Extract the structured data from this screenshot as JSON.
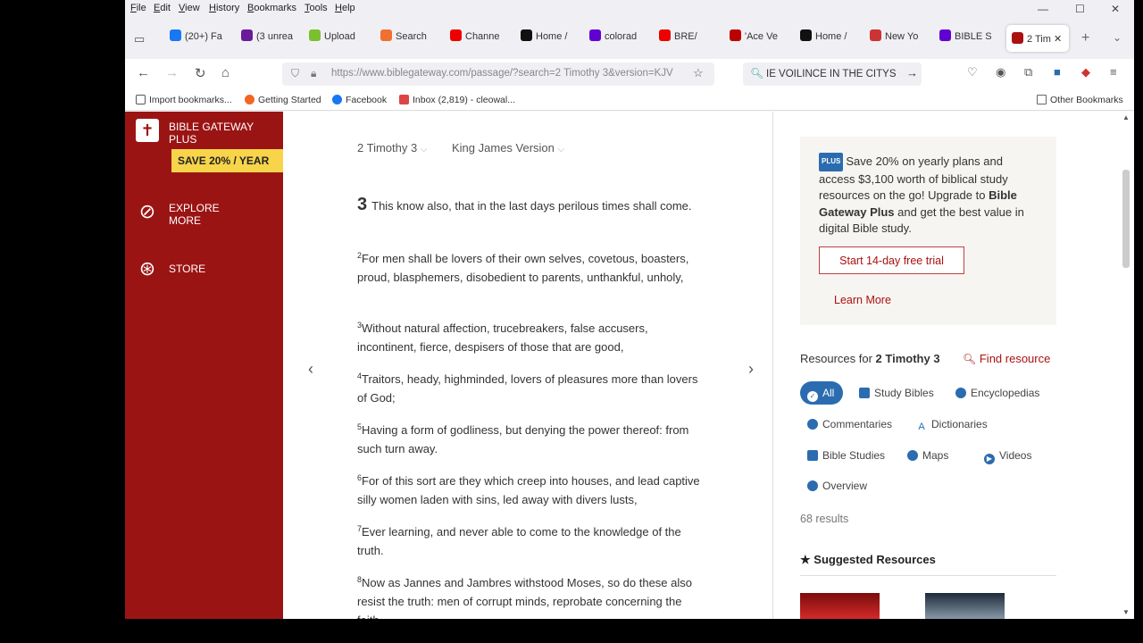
{
  "menu": [
    "File",
    "Edit",
    "View",
    "History",
    "Bookmarks",
    "Tools",
    "Help"
  ],
  "window_controls": {
    "minimize": "—",
    "maximize": "☐",
    "close": "✕"
  },
  "tabs": [
    {
      "label": "(20+) Fa",
      "color": "#1877f2"
    },
    {
      "label": "(3 unrea",
      "color": "#6a1b9a"
    },
    {
      "label": "Upload",
      "color": "#7cc02f"
    },
    {
      "label": "Search",
      "color": "#f07030"
    },
    {
      "label": "Channe",
      "color": "#e00"
    },
    {
      "label": "Home /",
      "color": "#111"
    },
    {
      "label": "colorad",
      "color": "#6001d2"
    },
    {
      "label": "BRE/",
      "color": "#e00"
    },
    {
      "label": "'Ace Ve",
      "color": "#b00"
    },
    {
      "label": "Home /",
      "color": "#111"
    },
    {
      "label": "New Yo",
      "color": "#c33"
    },
    {
      "label": "BIBLE S",
      "color": "#6001d2"
    },
    {
      "label": "2 Tim",
      "color": "#a11",
      "active": true
    }
  ],
  "nav": {
    "url": "https://www.biblegateway.com/passage/?search=2 Timothy 3&version=KJV",
    "search_text": "IE VOILINCE IN THE CITYS"
  },
  "bookmarks": [
    {
      "label": "Import bookmarks...",
      "color": "#555"
    },
    {
      "label": "Getting Started",
      "color": "#f26522"
    },
    {
      "label": "Facebook",
      "color": "#1877f2"
    },
    {
      "label": "Inbox (2,819) - cleowal...",
      "color": "#d44"
    }
  ],
  "other_bookmarks": "Other Bookmarks",
  "sidebar": {
    "plus_title": "BIBLE GATEWAY PLUS",
    "save_badge": "SAVE 20% / YEAR",
    "explore": "EXPLORE MORE",
    "store": "STORE"
  },
  "passage": {
    "book": "2 Timothy 3",
    "version": "King James Version",
    "chapter": "3",
    "verses": [
      {
        "num": "",
        "text": "This know also, that in the last days perilous times shall come."
      },
      {
        "num": "2",
        "text": "For men shall be lovers of their own selves, covetous, boasters, proud, blasphemers, disobedient to parents, unthankful, unholy,"
      },
      {
        "num": "3",
        "text": "Without natural affection, trucebreakers, false accusers, incontinent, fierce, despisers of those that are good,"
      },
      {
        "num": "4",
        "text": "Traitors, heady, highminded, lovers of pleasures more than lovers of God;"
      },
      {
        "num": "5",
        "text": "Having a form of godliness, but denying the power thereof: from such turn away."
      },
      {
        "num": "6",
        "text": "For of this sort are they which creep into houses, and lead captive silly women laden with sins, led away with divers lusts,"
      },
      {
        "num": "7",
        "text": "Ever learning, and never able to come to the knowledge of the truth."
      },
      {
        "num": "8",
        "text": "Now as Jannes and Jambres withstood Moses, so do these also resist the truth: men of corrupt minds, reprobate concerning the faith."
      }
    ]
  },
  "promo": {
    "badge": "PLUS",
    "text_1": "Save 20% on yearly plans and access $3,100 worth of biblical study resources on the go! Upgrade to",
    "brand": "Bible Gateway Plus",
    "text_2": "and get the best value in digital Bible study.",
    "trial_button": "Start 14-day free trial",
    "learn_more": "Learn More"
  },
  "resources": {
    "heading_prefix": "Resources for",
    "heading_ref": "2 Timothy 3",
    "find": "Find resource",
    "chips": [
      "All",
      "Study Bibles",
      "Encyclopedias",
      "Commentaries",
      "Dictionaries",
      "Bible Studies",
      "Maps",
      "Videos",
      "Overview"
    ],
    "results": "68 results",
    "suggested": "Suggested Resources"
  }
}
